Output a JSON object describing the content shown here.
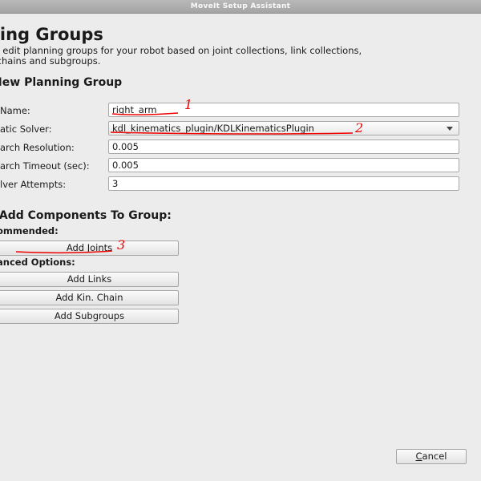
{
  "window": {
    "title": "MoveIt Setup Assistant"
  },
  "header": {
    "title": "nning Groups",
    "description_lines": [
      "and edit planning groups for your robot based on joint collections, link collections,",
      "tic chains and subgroups."
    ]
  },
  "form": {
    "section_title": "te New Planning Group",
    "fields": [
      {
        "label": "Name:",
        "value": "right_arm"
      },
      {
        "label": "atic Solver:",
        "value": "kdl_kinematics_plugin/KDLKinematicsPlugin"
      },
      {
        "label": "arch Resolution:",
        "value": "0.005"
      },
      {
        "label": "arch Timeout (sec):",
        "value": "0.005"
      },
      {
        "label": "lver Attempts:",
        "value": "3"
      }
    ]
  },
  "components": {
    "section_title": "t, Add Components To Group:",
    "recommended_label": "ommended:",
    "advanced_label": "anced Options:",
    "buttons": {
      "add_joints": "Add Joints",
      "add_links": "Add Links",
      "add_kin_chain": "Add Kin. Chain",
      "add_subgroups": "Add Subgroups"
    }
  },
  "footer": {
    "cancel_mnemonic": "C",
    "cancel_rest": "ancel"
  },
  "annotations": {
    "color": "#e00000",
    "marks": [
      "1",
      "2",
      "3"
    ]
  }
}
